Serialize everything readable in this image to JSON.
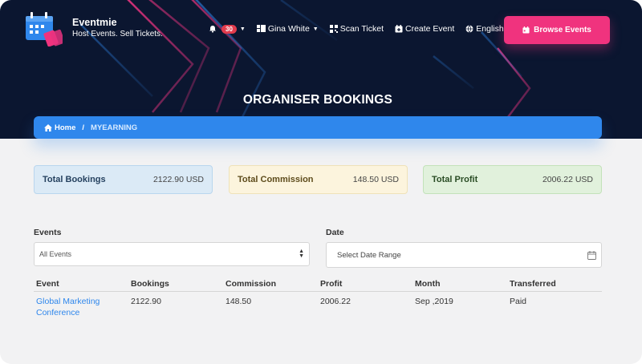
{
  "brand": {
    "name": "Eventmie",
    "tagline": "Host Events. Sell Tickets."
  },
  "nav": {
    "notifications_count": "30",
    "user_name": "Gina White",
    "scan_ticket": "Scan Ticket",
    "create_event": "Create Event",
    "language": "English",
    "browse_events": "Browse Events"
  },
  "page": {
    "title": "ORGANISER BOOKINGS"
  },
  "breadcrumb": {
    "home": "Home",
    "separator": "/",
    "current": "MYEARNING"
  },
  "summary": {
    "total_bookings": {
      "label": "Total Bookings",
      "value": "2122.90 USD"
    },
    "total_commission": {
      "label": "Total Commission",
      "value": "148.50 USD"
    },
    "total_profit": {
      "label": "Total Profit",
      "value": "2006.22 USD"
    }
  },
  "filters": {
    "events_label": "Events",
    "events_selected": "All Events",
    "date_label": "Date",
    "date_placeholder": "Select Date Range"
  },
  "table": {
    "headers": [
      "Event",
      "Bookings",
      "Commission",
      "Profit",
      "Month",
      "Transferred"
    ],
    "rows": [
      {
        "event_line1": "Global Marketing",
        "event_line2": "Conference",
        "bookings": "2122.90",
        "commission": "148.50",
        "profit": "2006.22",
        "month": "Sep ,2019",
        "transferred": "Paid"
      }
    ]
  },
  "colors": {
    "hero_bg": "#0b1630",
    "accent_pink": "#f0337e",
    "breadcrumb_blue": "#2f87ec",
    "link_blue": "#2f87ec"
  },
  "icons": [
    "calendar-tickets-logo",
    "bell-icon",
    "user-grid-icon",
    "qrcode-icon",
    "calendar-plus-icon",
    "globe-icon",
    "calendar-icon",
    "home-icon"
  ]
}
